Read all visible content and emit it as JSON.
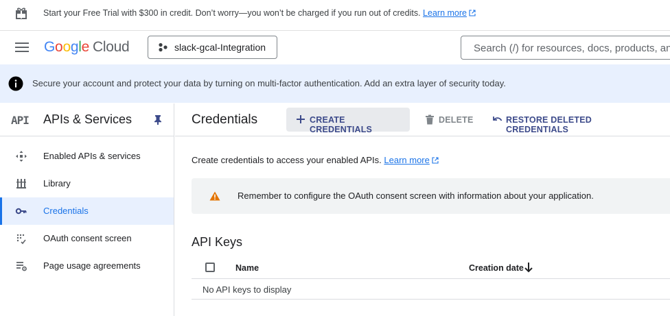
{
  "trial_banner": {
    "text": "Start your Free Trial with $300 in credit. Don’t worry—you won’t be charged if you run out of credits.",
    "link": "Learn more"
  },
  "header": {
    "logo": {
      "google": [
        "G",
        "o",
        "o",
        "g",
        "l",
        "e"
      ],
      "cloud": "Cloud"
    },
    "project_name": "slack-gcal-Integration",
    "search_placeholder": "Search (/) for resources, docs, products, and more"
  },
  "mfa_banner": {
    "text": "Secure your account and protect your data by turning on multi-factor authentication. Add an extra layer of security today."
  },
  "sidebar": {
    "icon_text": "API",
    "title": "APIs & Services",
    "items": [
      {
        "label": "Enabled APIs & services",
        "icon": "enabled-apis-icon"
      },
      {
        "label": "Library",
        "icon": "library-icon"
      },
      {
        "label": "Credentials",
        "icon": "key-icon",
        "active": true
      },
      {
        "label": "OAuth consent screen",
        "icon": "oauth-consent-icon"
      },
      {
        "label": "Page usage agreements",
        "icon": "page-usage-icon"
      }
    ]
  },
  "main": {
    "title": "Credentials",
    "toolbar": {
      "create": "CREATE CREDENTIALS",
      "delete": "DELETE",
      "restore": "RESTORE DELETED CREDENTIALS"
    },
    "intro": "Create credentials to access your enabled APIs.",
    "intro_link": "Learn more",
    "warning": "Remember to configure the OAuth consent screen with information about your application.",
    "api_keys": {
      "heading": "API Keys",
      "columns": [
        "Name",
        "Creation date"
      ],
      "empty": "No API keys to display"
    }
  },
  "colors": {
    "accent": "#1a73e8",
    "banner_bg": "#e8f0fe",
    "warning_icon": "#e37400"
  }
}
